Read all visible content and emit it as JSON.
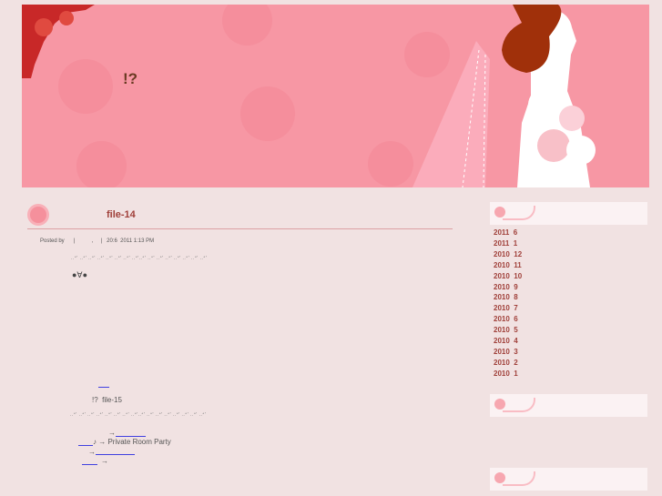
{
  "header": {
    "site_title": "!?"
  },
  "post": {
    "title": "file-14",
    "meta": "Posted by      |           ,     |   20:6  2011 1:13 PM",
    "dots": "..ᐤ' ..ᐤ' ..ᐤ' ..ᐤ' ..ᐤ' ..ᐤ' ..ᐤ' ..ᐤ'..ᐤ' ..ᐤ' ..ᐤ' ..ᐤ' ..ᐤ' ..ᐤ' ..ᐤ' ..ᐤ'",
    "face": "●∀●",
    "next_title": "!?  file-15",
    "arrow1": "→",
    "line2": "♪ → Private Room Party",
    "arrow2": "→",
    "arrow3": "→"
  },
  "sidebar": {
    "archives": [
      "2011  6",
      "2011  1",
      "2010  12",
      "2010  11",
      "2010  10",
      "2010  9",
      "2010  8",
      "2010  7",
      "2010  6",
      "2010  5",
      "2010  4",
      "2010  3",
      "2010  2",
      "2010  1"
    ]
  }
}
